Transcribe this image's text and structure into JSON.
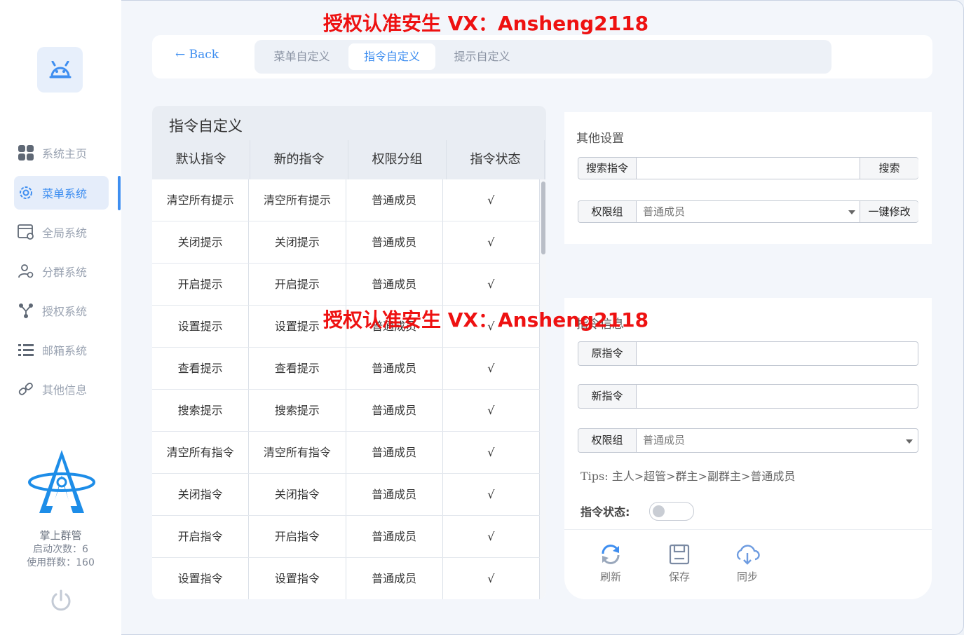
{
  "watermark": "授权认准安生 VX：Ansheng2118",
  "sidebar": {
    "items": [
      {
        "label": "系统主页",
        "icon": "grid-icon"
      },
      {
        "label": "菜单系统",
        "icon": "gear-icon"
      },
      {
        "label": "全局系统",
        "icon": "window-settings-icon"
      },
      {
        "label": "分群系统",
        "icon": "users-icon"
      },
      {
        "label": "授权系统",
        "icon": "branch-icon"
      },
      {
        "label": "邮箱系统",
        "icon": "list-icon"
      },
      {
        "label": "其他信息",
        "icon": "link-icon"
      }
    ],
    "brand_name": "掌上群管",
    "launch_count": "启动次数：6",
    "group_count": "使用群数：160"
  },
  "header": {
    "back_label": "← Back",
    "tabs": [
      {
        "label": "菜单自定义"
      },
      {
        "label": "指令自定义"
      },
      {
        "label": "提示自定义"
      }
    ]
  },
  "table": {
    "title": "指令自定义",
    "columns": [
      "默认指令",
      "新的指令",
      "权限分组",
      "指令状态"
    ],
    "rows": [
      [
        "清空所有提示",
        "清空所有提示",
        "普通成员",
        "√"
      ],
      [
        "关闭提示",
        "关闭提示",
        "普通成员",
        "√"
      ],
      [
        "开启提示",
        "开启提示",
        "普通成员",
        "√"
      ],
      [
        "设置提示",
        "设置提示",
        "普通成员",
        "√"
      ],
      [
        "查看提示",
        "查看提示",
        "普通成员",
        "√"
      ],
      [
        "搜索提示",
        "搜索提示",
        "普通成员",
        "√"
      ],
      [
        "清空所有指令",
        "清空所有指令",
        "普通成员",
        "√"
      ],
      [
        "关闭指令",
        "关闭指令",
        "普通成员",
        "√"
      ],
      [
        "开启指令",
        "开启指令",
        "普通成员",
        "√"
      ],
      [
        "设置指令",
        "设置指令",
        "普通成员",
        "√"
      ]
    ]
  },
  "other_settings": {
    "title": "其他设置",
    "search_label": "搜索指令",
    "search_value": "",
    "search_button": "搜索",
    "group_label": "权限组",
    "group_value": "普通成员",
    "bulk_button": "一键修改"
  },
  "info": {
    "title": "指令信息",
    "original_label": "原指令",
    "original_value": "",
    "new_label": "新指令",
    "new_value": "",
    "group_label": "权限组",
    "group_value": "普通成员",
    "tips": "Tips: 主人>超管>群主>副群主>普通成员",
    "status_label": "指令状态:"
  },
  "actions": [
    {
      "label": "刷新",
      "icon": "refresh-icon"
    },
    {
      "label": "保存",
      "icon": "save-icon"
    },
    {
      "label": "同步",
      "icon": "cloud-sync-icon"
    }
  ],
  "colors": {
    "accent": "#3e8ef0",
    "watermark": "#ee1111"
  }
}
